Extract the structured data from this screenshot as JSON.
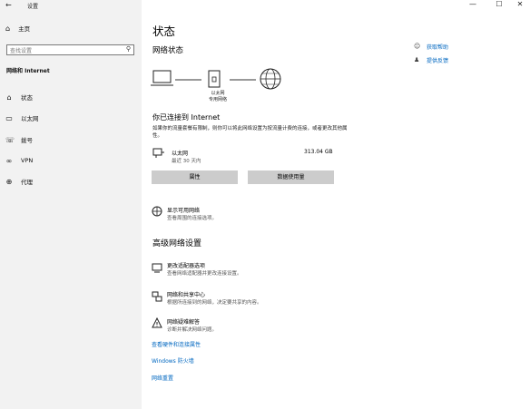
{
  "window": {
    "back_glyph": "←",
    "title": "设置",
    "minimize_glyph": "—",
    "maximize_glyph": "☐",
    "close_glyph": "✕"
  },
  "sidebar": {
    "home_label": "主页",
    "search_placeholder": "查找设置",
    "section_title": "网络和 Internet",
    "items": [
      {
        "label": "状态",
        "icon": "home-network-icon",
        "glyph": "⌂"
      },
      {
        "label": "以太网",
        "icon": "ethernet-icon",
        "glyph": "▭"
      },
      {
        "label": "拨号",
        "icon": "dialup-icon",
        "glyph": "☏"
      },
      {
        "label": "VPN",
        "icon": "vpn-icon",
        "glyph": "∞"
      },
      {
        "label": "代理",
        "icon": "proxy-icon",
        "glyph": "⊕"
      }
    ]
  },
  "main": {
    "page_title": "状态",
    "network_status_title": "网络状态",
    "diagram": {
      "router_label_1": "以太网",
      "router_label_2": "专用网络"
    },
    "connected_title": "你已连接到 Internet",
    "connected_desc": "如果你的流量套餐有限制，则你可以将此网络设置为按流量计费的连接，或者更改其他属性。",
    "connection": {
      "name": "以太网",
      "sub": "最近 30 天内",
      "usage": "313.04 GB"
    },
    "buttons": {
      "properties": "属性",
      "data_usage": "数据使用量"
    },
    "show_networks": {
      "title": "显示可用网络",
      "sub": "查看周围的连接选项。"
    },
    "advanced_title": "高级网络设置",
    "advanced_items": [
      {
        "title": "更改适配器选项",
        "sub": "查看网络适配器并更改连接设置。"
      },
      {
        "title": "网络和共享中心",
        "sub": "根据所连接到的网络，决定要共享的内容。"
      },
      {
        "title": "网络疑难解答",
        "sub": "诊断并解决网络问题。"
      }
    ],
    "links": [
      "查看硬件和连接属性",
      "Windows 防火墙",
      "网络重置"
    ]
  },
  "help": {
    "get_help": "获取帮助",
    "feedback": "提供反馈"
  },
  "colors": {
    "accent": "#0067c0",
    "sidebar_bg": "#f2f2f2",
    "button_bg": "#cccccc"
  }
}
